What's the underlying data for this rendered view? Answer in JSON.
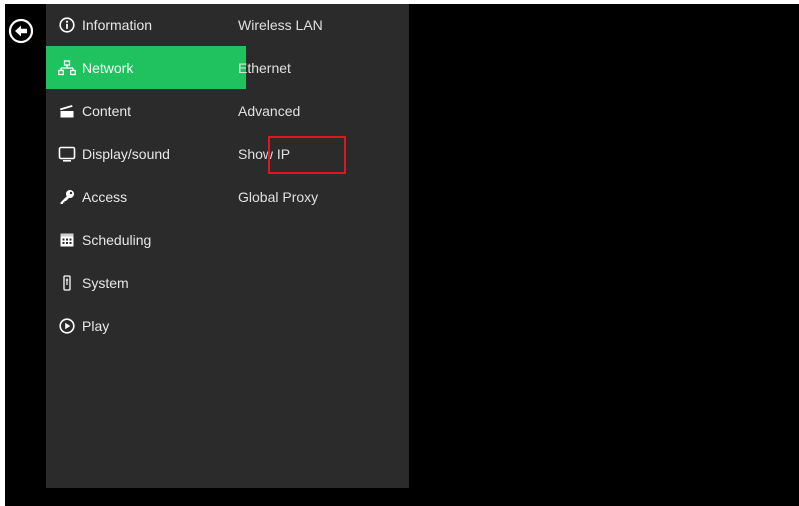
{
  "back_icon": "arrow-left-circle-icon",
  "menu": {
    "items": [
      {
        "label": "Information",
        "icon": "info-circle-icon"
      },
      {
        "label": "Network",
        "icon": "network-icon",
        "active": true
      },
      {
        "label": "Content",
        "icon": "clapperboard-icon"
      },
      {
        "label": "Display/sound",
        "icon": "monitor-icon"
      },
      {
        "label": "Access",
        "icon": "key-icon"
      },
      {
        "label": "Scheduling",
        "icon": "calendar-icon"
      },
      {
        "label": "System",
        "icon": "device-icon"
      },
      {
        "label": "Play",
        "icon": "play-circle-icon"
      }
    ]
  },
  "submenu": {
    "items": [
      {
        "label": "Wireless LAN"
      },
      {
        "label": "Ethernet"
      },
      {
        "label": "Advanced"
      },
      {
        "label": "Show IP",
        "highlighted": true
      },
      {
        "label": "Global Proxy"
      }
    ]
  },
  "colors": {
    "accent": "#1fc25e",
    "panel": "#2b2b2b",
    "background": "#000000",
    "highlight_border": "#e0161f"
  }
}
